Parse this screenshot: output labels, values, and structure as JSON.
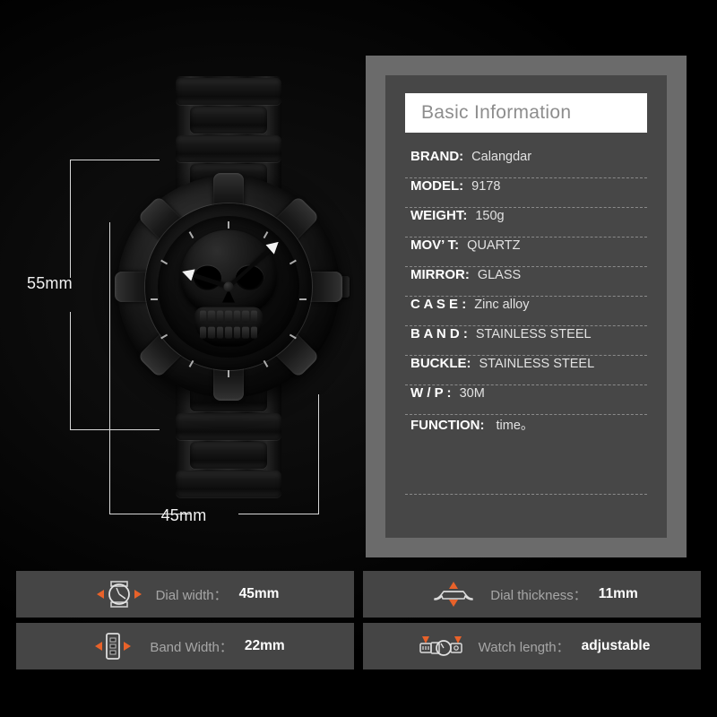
{
  "product": {
    "type": "wristwatch",
    "style": "skull dial men's quartz watch",
    "dimensions": {
      "vertical_label": "55mm",
      "horizontal_label": "45mm"
    }
  },
  "spec_panel": {
    "header": {
      "title": "Basic Information"
    },
    "rows": [
      {
        "label": "BRAND:",
        "value": "Calangdar"
      },
      {
        "label": "MODEL:",
        "value": "9178"
      },
      {
        "label": "WEIGHT:",
        "value": "150g"
      },
      {
        "label": "MOV’ T:",
        "value": "QUARTZ"
      },
      {
        "label": "MIRROR:",
        "value": "GLASS"
      },
      {
        "label": "C A S E :",
        "value": "Zinc alloy"
      },
      {
        "label": "B A N D :",
        "value": "STAINLESS STEEL"
      },
      {
        "label": "BUCKLE:",
        "value": "STAINLESS STEEL"
      },
      {
        "label": "W / P :",
        "value": "30M"
      },
      {
        "label": "FUNCTION:",
        "value": "time。"
      }
    ]
  },
  "info_cards": [
    {
      "icon": "watch-face-icon",
      "label": "Dial width：",
      "value": "45mm"
    },
    {
      "icon": "watch-profile-icon",
      "label": "Dial thickness：",
      "value": "11mm"
    },
    {
      "icon": "band-segment-icon",
      "label": "Band Width：",
      "value": "22mm"
    },
    {
      "icon": "watch-length-icon",
      "label": "Watch length：",
      "value": "adjustable"
    }
  ],
  "colors": {
    "background": "#000000",
    "panel_frame": "#6b6b6b",
    "panel_body": "#474747",
    "header_bg": "#ffffff",
    "header_text": "#8d8d8d",
    "card_bg": "#454545",
    "card_label": "#a6a6a6",
    "accent_orange": "#e8622a",
    "guide_line": "#d7d7d7"
  }
}
